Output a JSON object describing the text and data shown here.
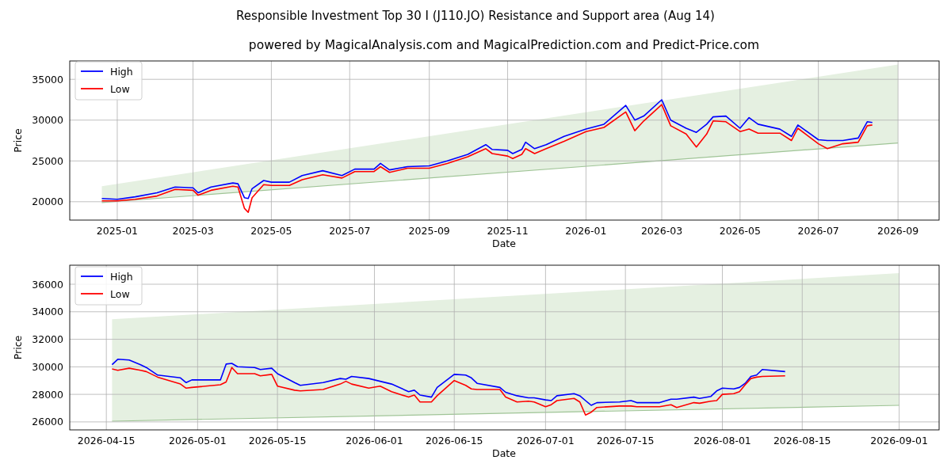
{
  "title": "Responsible Investment Top 30 I (J110.JO) Resistance and Support area (Aug 14)",
  "charts": [
    {
      "chart_data": {
        "type": "line",
        "title": "powered by MagicalAnalysis.com and MagicalPrediction.com and Predict-Price.com",
        "xlabel": "Date",
        "ylabel": "Price",
        "x": [
          "2024-12-20",
          "2025-01-01",
          "2025-01-15",
          "2025-02-01",
          "2025-02-15",
          "2025-03-01",
          "2025-03-05",
          "2025-03-15",
          "2025-04-01",
          "2025-04-05",
          "2025-04-10",
          "2025-04-13",
          "2025-04-16",
          "2025-04-25",
          "2025-05-01",
          "2025-05-15",
          "2025-05-25",
          "2025-06-10",
          "2025-06-25",
          "2025-07-05",
          "2025-07-20",
          "2025-07-25",
          "2025-08-01",
          "2025-08-15",
          "2025-09-01",
          "2025-09-15",
          "2025-10-01",
          "2025-10-15",
          "2025-10-20",
          "2025-11-01",
          "2025-11-05",
          "2025-11-12",
          "2025-11-15",
          "2025-11-22",
          "2025-12-01",
          "2025-12-15",
          "2026-01-01",
          "2026-01-15",
          "2026-02-01",
          "2026-02-08",
          "2026-02-15",
          "2026-03-01",
          "2026-03-08",
          "2026-03-20",
          "2026-03-28",
          "2026-04-05",
          "2026-04-10",
          "2026-04-20",
          "2026-05-01",
          "2026-05-08",
          "2026-05-15",
          "2026-06-01",
          "2026-06-10",
          "2026-06-15",
          "2026-07-01",
          "2026-07-08",
          "2026-07-20",
          "2026-08-01",
          "2026-08-08",
          "2026-08-12",
          "2026-09-01"
        ],
        "series": [
          {
            "name": "High",
            "color": "#0000ff",
            "values": [
              20400,
              20300,
              20600,
              21100,
              21800,
              21700,
              21100,
              21800,
              22300,
              22200,
              20500,
              20400,
              21600,
              22600,
              22400,
              22400,
              23200,
              23800,
              23200,
              24000,
              24000,
              24700,
              23900,
              24300,
              24400,
              25000,
              25800,
              27000,
              26400,
              26300,
              25900,
              26400,
              27300,
              26500,
              27000,
              28000,
              28900,
              29500,
              31800,
              30000,
              30500,
              32500,
              30000,
              29000,
              28500,
              29500,
              30400,
              30500,
              29000,
              30300,
              29500,
              28900,
              28000,
              29400,
              27600,
              27500,
              27500,
              27800,
              29800,
              29700,
              null
            ]
          },
          {
            "name": "Low",
            "color": "#ff0000",
            "values": [
              20100,
              20100,
              20300,
              20700,
              21500,
              21400,
              20800,
              21400,
              21900,
              21800,
              19200,
              18700,
              20500,
              22100,
              22000,
              22000,
              22700,
              23300,
              22900,
              23700,
              23700,
              24300,
              23600,
              24100,
              24100,
              24700,
              25500,
              26500,
              25900,
              25600,
              25300,
              25800,
              26500,
              25900,
              26500,
              27400,
              28600,
              29100,
              31000,
              28700,
              29900,
              31900,
              29300,
              28300,
              26700,
              28300,
              29900,
              29800,
              28600,
              28900,
              28400,
              28400,
              27500,
              29000,
              27100,
              26500,
              27100,
              27300,
              29300,
              29400,
              null
            ]
          },
          {
            "type": "area",
            "color": "#e5f0e1",
            "values": [
              21900,
              null,
              null,
              null,
              null,
              null,
              null,
              null,
              null,
              null,
              null,
              null,
              null,
              null,
              null,
              null,
              null,
              null,
              null,
              null,
              null,
              null,
              null,
              null,
              null,
              null,
              null,
              null,
              null,
              null,
              null,
              null,
              null,
              null,
              null,
              null,
              null,
              null,
              null,
              null,
              null,
              null,
              null,
              null,
              null,
              null,
              null,
              null,
              null,
              null,
              null,
              null,
              null,
              null,
              null,
              null,
              null,
              null,
              null,
              null,
              36800
            ]
          },
          {
            "color": "#9fc496",
            "values": [
              19900,
              null,
              null,
              null,
              null,
              null,
              null,
              null,
              null,
              null,
              null,
              null,
              null,
              null,
              null,
              null,
              null,
              null,
              null,
              null,
              null,
              null,
              null,
              null,
              null,
              null,
              null,
              null,
              null,
              null,
              null,
              null,
              null,
              null,
              null,
              null,
              null,
              null,
              null,
              null,
              null,
              null,
              null,
              null,
              null,
              null,
              null,
              null,
              null,
              null,
              null,
              null,
              null,
              null,
              null,
              null,
              null,
              null,
              null,
              null,
              27200
            ]
          }
        ],
        "xlim": [
          "2024-11-25",
          "2026-10-03"
        ],
        "ylim": [
          17750,
          37250
        ],
        "xticks": [
          {
            "value": "2025-01-01",
            "label": "2025-01"
          },
          {
            "value": "2025-03-01",
            "label": "2025-03"
          },
          {
            "value": "2025-05-01",
            "label": "2025-05"
          },
          {
            "value": "2025-07-01",
            "label": "2025-07"
          },
          {
            "value": "2025-09-01",
            "label": "2025-09"
          },
          {
            "value": "2025-11-01",
            "label": "2025-11"
          },
          {
            "value": "2026-01-01",
            "label": "2026-01"
          },
          {
            "value": "2026-03-01",
            "label": "2026-03"
          },
          {
            "value": "2026-05-01",
            "label": "2026-05"
          },
          {
            "value": "2026-07-01",
            "label": "2026-07"
          },
          {
            "value": "2026-09-01",
            "label": "2026-09"
          }
        ],
        "yticks": [
          20000,
          25000,
          30000,
          35000
        ],
        "grid": true,
        "legend": true
      }
    },
    {
      "chart_data": {
        "type": "line",
        "xlabel": "Date",
        "ylabel": "Price",
        "x": [
          "2026-04-16",
          "2026-04-17",
          "2026-04-19",
          "2026-04-21",
          "2026-04-22",
          "2026-04-24",
          "2026-04-28",
          "2026-04-29",
          "2026-04-30",
          "2026-05-05",
          "2026-05-06",
          "2026-05-07",
          "2026-05-08",
          "2026-05-11",
          "2026-05-12",
          "2026-05-14",
          "2026-05-15",
          "2026-05-18",
          "2026-05-19",
          "2026-05-23",
          "2026-05-26",
          "2026-05-27",
          "2026-05-28",
          "2026-05-31",
          "2026-06-02",
          "2026-06-04",
          "2026-06-07",
          "2026-06-08",
          "2026-06-09",
          "2026-06-11",
          "2026-06-12",
          "2026-06-15",
          "2026-06-17",
          "2026-06-18",
          "2026-06-19",
          "2026-06-23",
          "2026-06-24",
          "2026-06-26",
          "2026-06-28",
          "2026-06-29",
          "2026-07-01",
          "2026-07-02",
          "2026-07-03",
          "2026-07-06",
          "2026-07-07",
          "2026-07-08",
          "2026-07-09",
          "2026-07-10",
          "2026-07-14",
          "2026-07-16",
          "2026-07-17",
          "2026-07-21",
          "2026-07-23",
          "2026-07-24",
          "2026-07-27",
          "2026-07-28",
          "2026-07-30",
          "2026-07-31",
          "2026-08-01",
          "2026-08-03",
          "2026-08-04",
          "2026-08-05",
          "2026-08-06",
          "2026-08-07",
          "2026-08-08",
          "2026-08-12",
          "2026-09-01"
        ],
        "series": [
          {
            "name": "High",
            "color": "#0000ff",
            "values": [
              30150,
              30550,
              30500,
              30150,
              29950,
              29400,
              29200,
              28850,
              29050,
              29050,
              30200,
              30250,
              30000,
              29950,
              29800,
              29900,
              29500,
              28850,
              28650,
              28850,
              29150,
              29100,
              29300,
              29150,
              28950,
              28750,
              28200,
              28300,
              27950,
              27800,
              28500,
              29450,
              29400,
              29200,
              28800,
              28500,
              28150,
              27900,
              27750,
              27750,
              27600,
              27550,
              27900,
              28050,
              27900,
              27550,
              27200,
              27400,
              27450,
              27550,
              27400,
              27400,
              27650,
              27650,
              27800,
              27700,
              27850,
              28250,
              28450,
              28400,
              28500,
              28800,
              29300,
              29400,
              29800,
              29650,
              null
            ]
          },
          {
            "name": "Low",
            "color": "#ff0000",
            "values": [
              29850,
              29750,
              29900,
              29750,
              29650,
              29250,
              28750,
              28450,
              28500,
              28700,
              28900,
              29950,
              29500,
              29500,
              29350,
              29450,
              28600,
              28300,
              28250,
              28350,
              28750,
              28950,
              28750,
              28450,
              28600,
              28200,
              27800,
              27950,
              27450,
              27450,
              27900,
              29000,
              28650,
              28400,
              28350,
              28350,
              27800,
              27450,
              27500,
              27450,
              27100,
              27250,
              27550,
              27700,
              27450,
              26500,
              26700,
              27050,
              27150,
              27150,
              27100,
              27100,
              27250,
              27050,
              27400,
              27350,
              27500,
              27550,
              28000,
              28050,
              28200,
              28700,
              29150,
              29250,
              29300,
              29350,
              null
            ]
          },
          {
            "type": "area",
            "color": "#e5f0e1",
            "values": [
              33450,
              null,
              null,
              null,
              null,
              null,
              null,
              null,
              null,
              null,
              null,
              null,
              null,
              null,
              null,
              null,
              null,
              null,
              null,
              null,
              null,
              null,
              null,
              null,
              null,
              null,
              null,
              null,
              null,
              null,
              null,
              null,
              null,
              null,
              null,
              null,
              null,
              null,
              null,
              null,
              null,
              null,
              null,
              null,
              null,
              null,
              null,
              null,
              null,
              null,
              null,
              null,
              null,
              null,
              null,
              null,
              null,
              null,
              null,
              null,
              null,
              null,
              null,
              null,
              null,
              null,
              36800
            ]
          },
          {
            "color": "#9fc496",
            "values": [
              26050,
              null,
              null,
              null,
              null,
              null,
              null,
              null,
              null,
              null,
              null,
              null,
              null,
              null,
              null,
              null,
              null,
              null,
              null,
              null,
              null,
              null,
              null,
              null,
              null,
              null,
              null,
              null,
              null,
              null,
              null,
              null,
              null,
              null,
              null,
              null,
              null,
              null,
              null,
              null,
              null,
              null,
              null,
              null,
              null,
              null,
              null,
              null,
              null,
              null,
              null,
              null,
              null,
              null,
              null,
              null,
              null,
              null,
              null,
              null,
              null,
              null,
              null,
              null,
              null,
              null,
              27200
            ]
          }
        ],
        "xlim": [
          "2026-04-08T14:00",
          "2026-09-08"
        ],
        "ylim": [
          25420,
          37380
        ],
        "xticks": [
          {
            "value": "2026-04-15",
            "label": "2026-04-15"
          },
          {
            "value": "2026-05-01",
            "label": "2026-05-01"
          },
          {
            "value": "2026-05-15",
            "label": "2026-05-15"
          },
          {
            "value": "2026-06-01",
            "label": "2026-06-01"
          },
          {
            "value": "2026-06-15",
            "label": "2026-06-15"
          },
          {
            "value": "2026-07-01",
            "label": "2026-07-01"
          },
          {
            "value": "2026-07-15",
            "label": "2026-07-15"
          },
          {
            "value": "2026-08-01",
            "label": "2026-08-01"
          },
          {
            "value": "2026-08-15",
            "label": "2026-08-15"
          },
          {
            "value": "2026-09-01",
            "label": "2026-09-01"
          }
        ],
        "yticks": [
          26000,
          28000,
          30000,
          32000,
          34000,
          36000
        ],
        "grid": true,
        "legend": true
      }
    }
  ]
}
